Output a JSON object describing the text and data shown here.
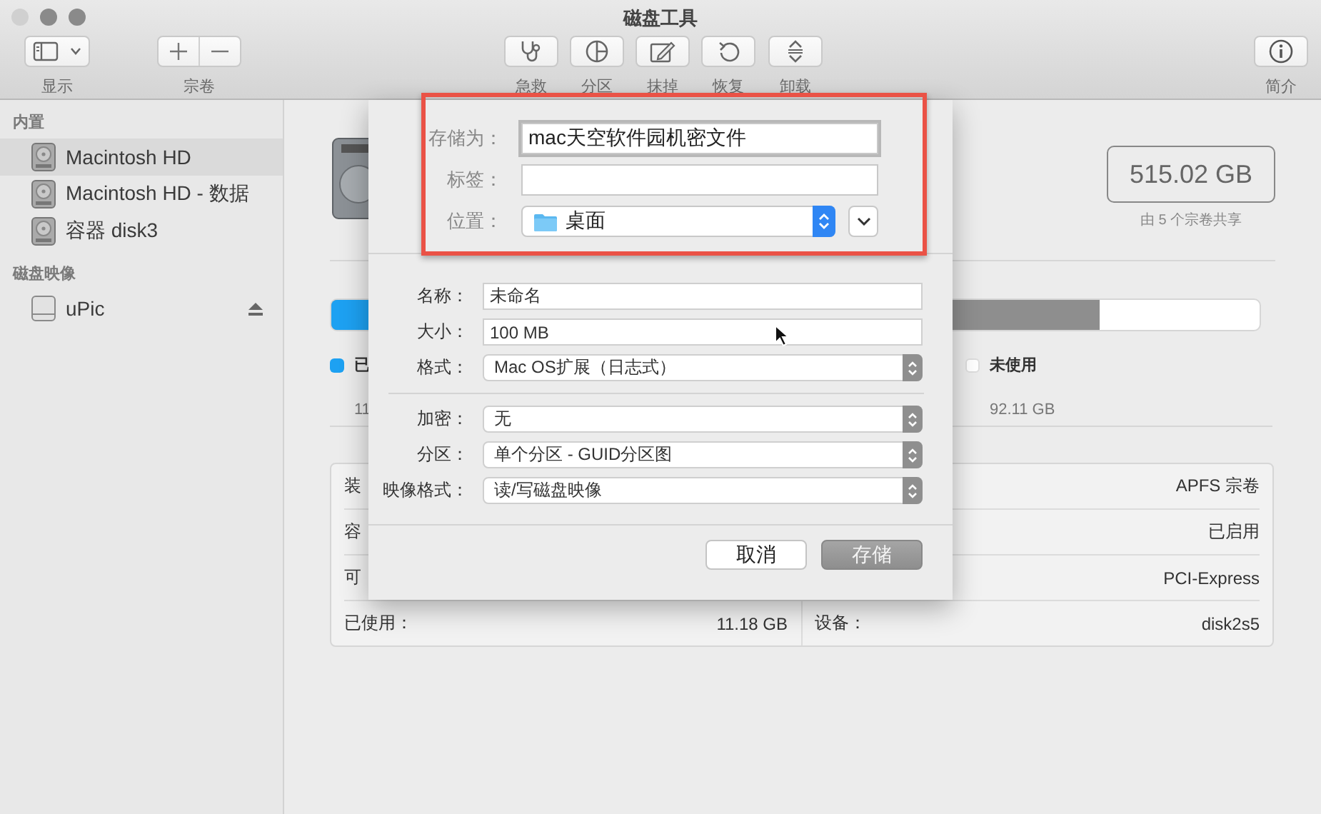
{
  "window": {
    "title": "磁盘工具"
  },
  "toolbar": {
    "items": [
      {
        "kind": "view",
        "label": "显示"
      },
      {
        "kind": "volume",
        "label": "宗卷"
      },
      {
        "kind": "first_aid",
        "label": "急救"
      },
      {
        "kind": "partition",
        "label": "分区"
      },
      {
        "kind": "erase",
        "label": "抹掉"
      },
      {
        "kind": "restore",
        "label": "恢复"
      },
      {
        "kind": "unmount",
        "label": "卸载"
      },
      {
        "kind": "info",
        "label": "简介"
      }
    ]
  },
  "sidebar": {
    "sections": [
      {
        "title": "内置",
        "items": [
          {
            "kind": "internal",
            "label": "Macintosh HD",
            "selected": true,
            "ejectable": false
          },
          {
            "kind": "internal",
            "label": "Macintosh HD - 数据",
            "selected": false,
            "ejectable": false
          },
          {
            "kind": "internal",
            "label": "容器 disk3",
            "selected": false,
            "ejectable": false
          }
        ]
      },
      {
        "title": "磁盘映像",
        "items": [
          {
            "kind": "image",
            "label": "uPic",
            "selected": false,
            "ejectable": true
          }
        ]
      }
    ]
  },
  "main": {
    "capacity": "515.02 GB",
    "capacity_note": "由 5 个宗卷共享",
    "usage_bar": {
      "segments": [
        {
          "color": "#1da1f2",
          "level": 0.1
        },
        {
          "color": "#8e8e8e",
          "level": 0.827
        }
      ]
    },
    "legend": [
      {
        "label": "已",
        "value": "11",
        "color": "#1da1f2"
      },
      {
        "label": "未使用",
        "value": "92.11 GB",
        "color": "#ffffff"
      }
    ],
    "info_rows": [
      {
        "left_label": "装",
        "right_value": "APFS 宗卷"
      },
      {
        "left_label": "容",
        "right_value": "已启用"
      },
      {
        "left_label": "可",
        "right_value": "PCI-Express"
      },
      {
        "left_label": "已使用：",
        "left_value": "11.18 GB",
        "right_label": "设备：",
        "right_value": "disk2s5"
      }
    ]
  },
  "sheet": {
    "highlighted": true,
    "save_as": {
      "label": "存储为：",
      "value": "mac天空软件园机密文件"
    },
    "tags": {
      "label": "标签："
    },
    "location": {
      "label": "位置：",
      "value": "桌面",
      "expanded": false
    },
    "fields": [
      {
        "kind": "text",
        "label": "名称：",
        "value": "未命名"
      },
      {
        "kind": "text",
        "label": "大小：",
        "value": "100 MB"
      },
      {
        "kind": "popup",
        "label": "格式：",
        "value": "Mac OS扩展（日志式）"
      },
      {
        "kind": "divider"
      },
      {
        "kind": "popup",
        "label": "加密：",
        "value": "无"
      },
      {
        "kind": "popup",
        "label": "分区：",
        "value": "单个分区 - GUID分区图"
      },
      {
        "kind": "popup",
        "label": "映像格式：",
        "value": "读/写磁盘映像"
      }
    ],
    "buttons": [
      {
        "label": "取消",
        "default": false
      },
      {
        "label": "存储",
        "default": true
      }
    ]
  }
}
